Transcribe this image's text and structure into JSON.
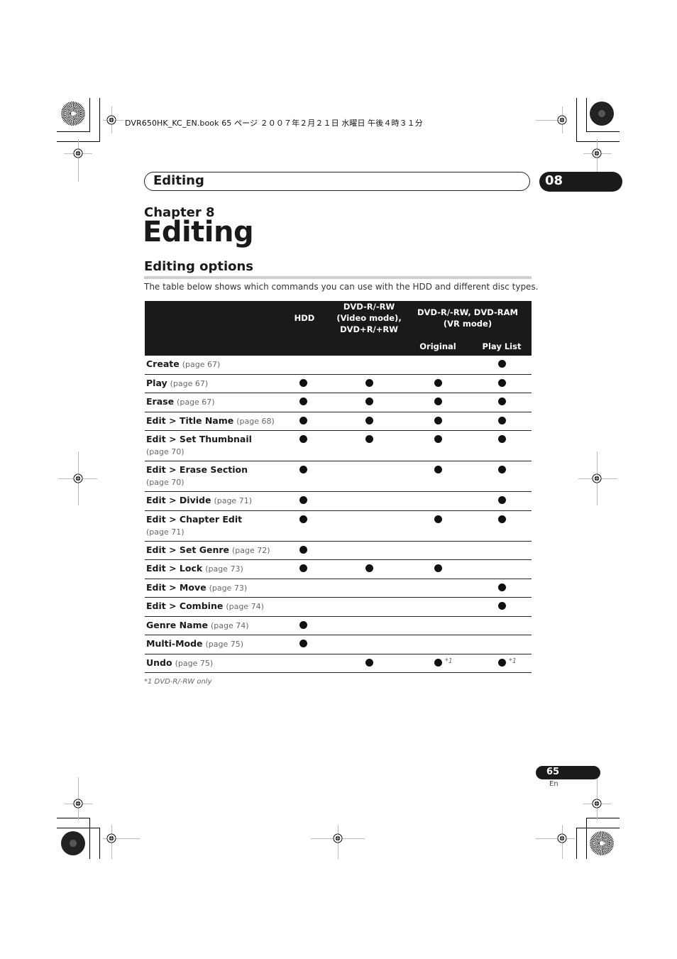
{
  "slug": "DVR650HK_KC_EN.book  65 ページ  ２００７年２月２１日  水曜日  午後４時３１分",
  "header": {
    "title": "Editing",
    "chapter_number": "08"
  },
  "chapter": {
    "label": "Chapter 8",
    "title": "Editing"
  },
  "section": {
    "title": "Editing options",
    "intro": "The table below shows which commands you can use with the HDD and different disc types."
  },
  "table": {
    "headers": {
      "hdd": "HDD",
      "dvd_video": [
        "DVD-R/-RW",
        "(Video mode),",
        "DVD+R/+RW"
      ],
      "dvd_vr": [
        "DVD-R/-RW, DVD-RAM",
        "(VR mode)"
      ],
      "original": "Original",
      "playlist": "Play List"
    },
    "rows": [
      {
        "name": "Create",
        "page": "(page 67)",
        "hdd": false,
        "video": false,
        "original": false,
        "playlist": true
      },
      {
        "name": "Play",
        "page": "(page 67)",
        "hdd": true,
        "video": true,
        "original": true,
        "playlist": true
      },
      {
        "name": "Erase",
        "page": "(page 67)",
        "hdd": true,
        "video": true,
        "original": true,
        "playlist": true
      },
      {
        "name": "Edit > Title Name",
        "page": "(page 68)",
        "hdd": true,
        "video": true,
        "original": true,
        "playlist": true
      },
      {
        "name": "Edit > Set Thumbnail",
        "page": "(page 70)",
        "wrap": true,
        "hdd": true,
        "video": true,
        "original": true,
        "playlist": true
      },
      {
        "name": "Edit > Erase Section",
        "page": "(page 70)",
        "wrap": true,
        "hdd": true,
        "video": false,
        "original": true,
        "playlist": true
      },
      {
        "name": "Edit > Divide",
        "page": "(page 71)",
        "hdd": true,
        "video": false,
        "original": false,
        "playlist": true
      },
      {
        "name": "Edit > Chapter Edit",
        "page": "(page 71)",
        "wrap": true,
        "hdd": true,
        "video": false,
        "original": true,
        "playlist": true
      },
      {
        "name": "Edit > Set Genre",
        "page": "(page 72)",
        "hdd": true,
        "video": false,
        "original": false,
        "playlist": false
      },
      {
        "name": "Edit > Lock",
        "page": "(page 73)",
        "hdd": true,
        "video": true,
        "original": true,
        "playlist": false
      },
      {
        "name": "Edit > Move",
        "page": "(page 73)",
        "hdd": false,
        "video": false,
        "original": false,
        "playlist": true
      },
      {
        "name": "Edit > Combine",
        "page": "(page 74)",
        "hdd": false,
        "video": false,
        "original": false,
        "playlist": true
      },
      {
        "name": "Genre Name",
        "page": "(page 74)",
        "hdd": true,
        "video": false,
        "original": false,
        "playlist": false
      },
      {
        "name": "Multi-Mode",
        "page": "(page 75)",
        "hdd": true,
        "video": false,
        "original": false,
        "playlist": false
      },
      {
        "name": "Undo",
        "page": "(page 75)",
        "hdd": false,
        "video": true,
        "original": true,
        "original_note": "*1",
        "playlist": true,
        "playlist_note": "*1"
      }
    ]
  },
  "footnote": "*1 DVD-R/-RW only",
  "footer": {
    "page_number": "65",
    "language": "En"
  }
}
